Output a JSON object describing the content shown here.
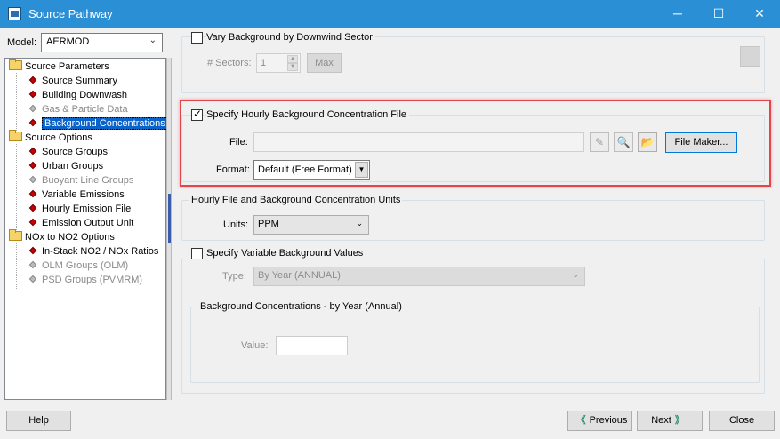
{
  "window": {
    "title": "Source Pathway",
    "minimize": "─",
    "maximize": "☐",
    "close": "✕"
  },
  "left": {
    "model_label": "Model:",
    "model_value": "AERMOD",
    "tree": [
      {
        "label": "Source Parameters",
        "type": "folder"
      },
      {
        "label": "Source Summary",
        "type": "leaf",
        "enabled": true
      },
      {
        "label": "Building Downwash",
        "type": "leaf",
        "enabled": true
      },
      {
        "label": "Gas & Particle Data",
        "type": "leaf",
        "enabled": false
      },
      {
        "label": "Background Concentrations",
        "type": "leaf",
        "enabled": true,
        "selected": true
      },
      {
        "label": "Source Options",
        "type": "folder"
      },
      {
        "label": "Source Groups",
        "type": "leaf",
        "enabled": true
      },
      {
        "label": "Urban Groups",
        "type": "leaf",
        "enabled": true
      },
      {
        "label": "Buoyant Line Groups",
        "type": "leaf",
        "enabled": false
      },
      {
        "label": "Variable Emissions",
        "type": "leaf",
        "enabled": true
      },
      {
        "label": "Hourly Emission File",
        "type": "leaf",
        "enabled": true
      },
      {
        "label": "Emission Output Unit",
        "type": "leaf",
        "enabled": true
      },
      {
        "label": "NOx to NO2 Options",
        "type": "folder"
      },
      {
        "label": "In-Stack NO2 / NOx Ratios",
        "type": "leaf",
        "enabled": true
      },
      {
        "label": "OLM Groups (OLM)",
        "type": "leaf",
        "enabled": false
      },
      {
        "label": "PSD Groups (PVMRM)",
        "type": "leaf",
        "enabled": false
      }
    ]
  },
  "sector": {
    "checkbox_label": "Vary Background by Downwind Sector",
    "checked": false,
    "sectors_label": "# Sectors:",
    "sectors_value": "1",
    "max_button": "Max"
  },
  "hourly_file": {
    "checkbox_label": "Specify Hourly Background Concentration File",
    "checked": true,
    "file_label": "File:",
    "file_value": "",
    "format_label": "Format:",
    "format_value": "Default (Free Format)",
    "file_maker_button": "File Maker...",
    "highlight_color": "#e0474c"
  },
  "units": {
    "group_title": "Hourly File and Background Concentration Units",
    "units_label": "Units:",
    "units_value": "PPM"
  },
  "variable": {
    "checkbox_label": "Specify Variable Background Values",
    "checked": false,
    "type_label": "Type:",
    "type_value": "By Year (ANNUAL)",
    "group_title": "Background Concentrations - by Year (Annual)",
    "value_label": "Value:",
    "value_value": ""
  },
  "buttons": {
    "help": "Help",
    "previous": "Previous",
    "next": "Next",
    "close": "Close"
  },
  "icons": {
    "prev_arrow": "《",
    "next_arrow": "》"
  }
}
